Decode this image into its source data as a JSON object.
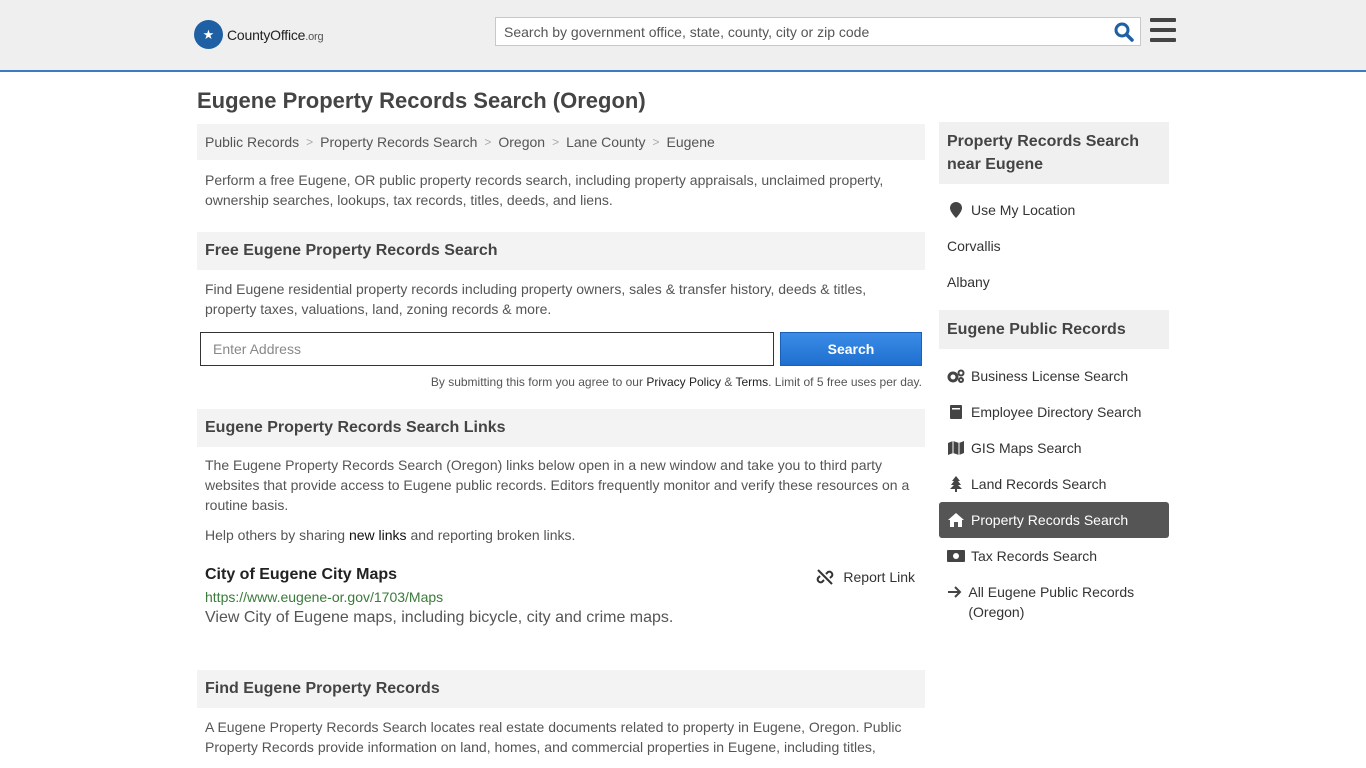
{
  "header": {
    "logo_brand": "CountyOffice",
    "logo_tld": ".org",
    "search_placeholder": "Search by government office, state, county, city or zip code"
  },
  "page_title": "Eugene Property Records Search (Oregon)",
  "breadcrumb": [
    "Public Records",
    "Property Records Search",
    "Oregon",
    "Lane County",
    "Eugene"
  ],
  "intro": "Perform a free Eugene, OR public property records search, including property appraisals, unclaimed property, ownership searches, lookups, tax records, titles, deeds, and liens.",
  "free_search": {
    "heading": "Free Eugene Property Records Search",
    "desc": "Find Eugene residential property records including property owners, sales & transfer history, deeds & titles, property taxes, valuations, land, zoning records & more.",
    "address_placeholder": "Enter Address",
    "button": "Search",
    "terms_prefix": "By submitting this form you agree to our ",
    "privacy": "Privacy Policy",
    "amp": " & ",
    "terms": "Terms",
    "terms_suffix": ". Limit of 5 free uses per day."
  },
  "links_section": {
    "heading": "Eugene Property Records Search Links",
    "desc": "The Eugene Property Records Search (Oregon) links below open in a new window and take you to third party websites that provide access to Eugene public records. Editors frequently monitor and verify these resources on a routine basis.",
    "help_prefix": "Help others by sharing ",
    "help_link": "new links",
    "help_suffix": " and reporting broken links.",
    "items": [
      {
        "title": "City of Eugene City Maps",
        "url": "https://www.eugene-or.gov/1703/Maps",
        "desc": "View City of Eugene maps, including bicycle, city and crime maps.",
        "report": "Report Link"
      }
    ]
  },
  "find_section": {
    "heading": "Find Eugene Property Records",
    "desc": "A Eugene Property Records Search locates real estate documents related to property in Eugene, Oregon. Public Property Records provide information on land, homes, and commercial properties in Eugene, including titles,"
  },
  "sidebar": {
    "nearby_heading": "Property Records Search near Eugene",
    "use_location": "Use My Location",
    "nearby": [
      "Corvallis",
      "Albany"
    ],
    "public_heading": "Eugene Public Records",
    "records": [
      {
        "label": "Business License Search",
        "icon": "gears-icon"
      },
      {
        "label": "Employee Directory Search",
        "icon": "book-icon"
      },
      {
        "label": "GIS Maps Search",
        "icon": "map-icon"
      },
      {
        "label": "Land Records Search",
        "icon": "tree-icon"
      },
      {
        "label": "Property Records Search",
        "icon": "home-icon",
        "active": true
      },
      {
        "label": "Tax Records Search",
        "icon": "money-icon"
      },
      {
        "label": "All Eugene Public Records (Oregon)",
        "icon": "arrow-right-icon"
      }
    ]
  },
  "colors": {
    "accent": "#3d7bc0",
    "button": "#1f6fd0",
    "active_bg": "#555555",
    "url_green": "#3a7a3a"
  }
}
